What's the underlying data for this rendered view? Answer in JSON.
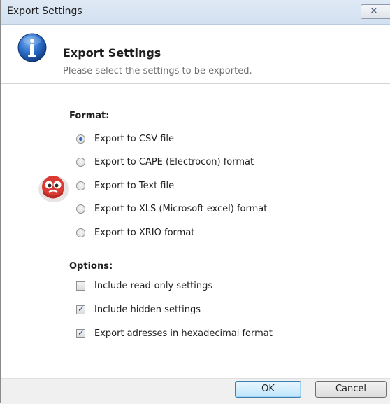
{
  "window": {
    "title": "Export Settings",
    "close_glyph": "✕"
  },
  "header": {
    "title": "Export Settings",
    "subtitle": "Please select the settings to be exported.",
    "icon": "info-icon"
  },
  "format": {
    "label": "Format:",
    "options": [
      {
        "label": "Export to CSV file",
        "checked": true
      },
      {
        "label": "Export to CAPE (Electrocon) format",
        "checked": false
      },
      {
        "label": "Export to Text file",
        "checked": false
      },
      {
        "label": "Export to XLS (Microsoft excel) format",
        "checked": false
      },
      {
        "label": "Export to XRIO format",
        "checked": false
      }
    ]
  },
  "options": {
    "label": "Options:",
    "items": [
      {
        "label": "Include read-only settings",
        "checked": false
      },
      {
        "label": "Include hidden settings",
        "checked": true
      },
      {
        "label": "Export adresses in hexadecimal format",
        "checked": true
      }
    ]
  },
  "buttons": {
    "ok": "OK",
    "cancel": "Cancel"
  },
  "colors": {
    "titlebar": "#d2e0f0",
    "accent": "#3c7fb1",
    "info_icon": "#1f5fb8"
  }
}
